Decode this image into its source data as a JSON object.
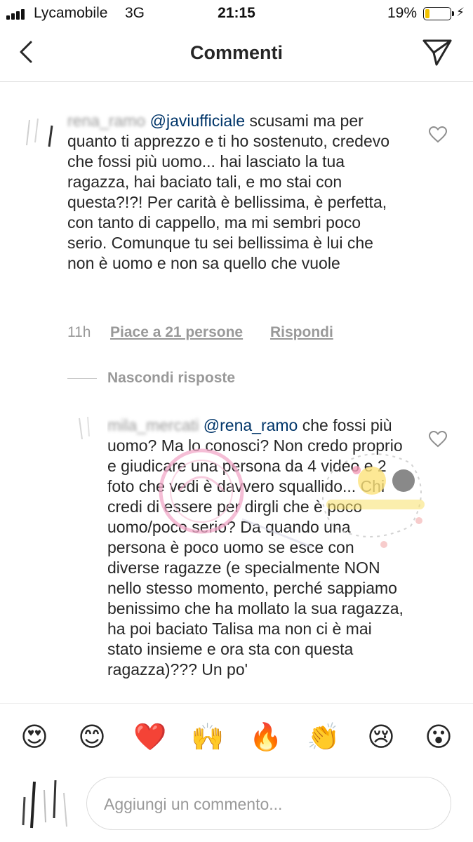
{
  "status_bar": {
    "carrier": "Lycamobile",
    "network": "3G",
    "time": "21:15",
    "battery_percent": "19%",
    "battery_level": 0.19
  },
  "nav": {
    "title": "Commenti",
    "back_icon": "chevron-left-icon",
    "send_icon": "paper-plane-icon"
  },
  "comments": [
    {
      "username": "rena_ramo",
      "mention": "@javiufficiale",
      "text": " scusami ma per quanto  ti apprezzo  e ti ho sostenuto,  credevo  che fossi più uomo... hai lasciato  la tua ragazza, hai baciato tali, e mo stai con questa?!?! Per carità  è  bellissima, è  perfetta,  con tanto di cappello,  ma mi sembri poco serio. Comunque  tu sei bellissima è  lui che non è  uomo e non sa quello che vuole",
      "time": "11h",
      "likes_label": "Piace a 21 persone",
      "reply_label": "Rispondi"
    }
  ],
  "hide_replies_label": "Nascondi risposte",
  "replies": [
    {
      "username": "mila_mercati",
      "mention": "@rena_ramo",
      "text": " che fossi più uomo? Ma lo conosci? Non credo proprio e giudicare una persona da 4 video e 2 foto che vedi è davvero squallido... Chi credi di essere per dirgli che è poco uomo/poco serio? Da quando una persona è poco uomo se esce con diverse ragazze (e specialmente NON nello stesso momento, perché sappiamo benissimo che ha mollato la sua ragazza, ha poi baciato Talisa ma non ci è mai stato insieme e ora sta con questa ragazza)??? Un po'"
    }
  ],
  "emoji_bar": [
    "😍",
    "😊",
    "❤️",
    "🙌",
    "🔥",
    "👏",
    "😢",
    "😮"
  ],
  "comment_input": {
    "placeholder": "Aggiungi un commento..."
  },
  "colors": {
    "mention": "#003569",
    "secondary_text": "#999999",
    "divider": "#dbdbdb",
    "battery_fill": "#f2c200"
  }
}
